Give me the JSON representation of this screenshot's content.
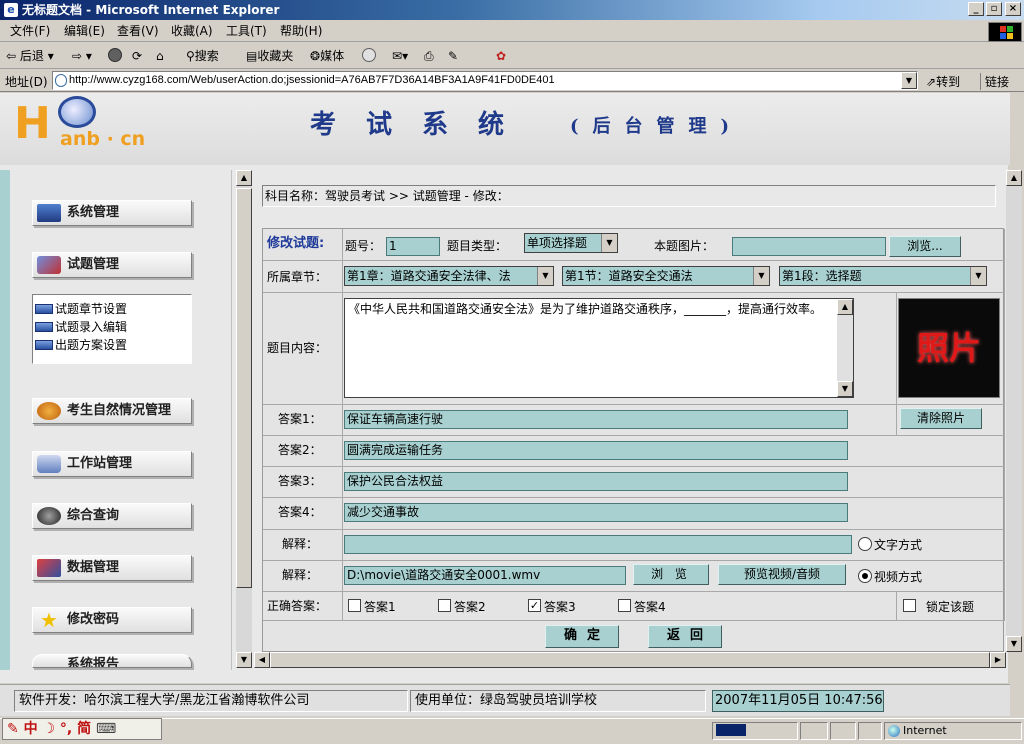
{
  "window": {
    "title": "无标题文档 - Microsoft Internet Explorer",
    "buttons": {
      "minimize": "_",
      "maximize": "▫",
      "close": "×"
    }
  },
  "menu": [
    "文件(F)",
    "编辑(E)",
    "查看(V)",
    "收藏(A)",
    "工具(T)",
    "帮助(H)"
  ],
  "toolbar": {
    "back": "后退",
    "search": "搜索",
    "favorites": "收藏夹",
    "media": "媒体"
  },
  "address": {
    "label": "地址(D)",
    "url": "http://www.cyzg168.com/Web/userAction.do;jsessionid=A76AB7F7D36A14BF3A1A9F41FD0DE401",
    "go": "转到",
    "links": "链接"
  },
  "header": {
    "logo_h": "H",
    "logo_text": "anb · cn",
    "title": "考试系统",
    "subtitle": "(后台管理)"
  },
  "sidebar": {
    "items": [
      {
        "label": "系统管理"
      },
      {
        "label": "试题管理"
      },
      {
        "label": "考生自然情况管理"
      },
      {
        "label": "工作站管理"
      },
      {
        "label": "综合查询"
      },
      {
        "label": "数据管理"
      },
      {
        "label": "修改密码"
      },
      {
        "label": "系统报告"
      }
    ],
    "subitems": [
      {
        "label": "试题章节设置"
      },
      {
        "label": "试题录入编辑"
      },
      {
        "label": "出题方案设置"
      }
    ]
  },
  "breadcrumb": "科目名称：驾驶员考试 >> 试题管理 - 修改：",
  "form": {
    "heading": "修改试题:",
    "num_label": "题号：",
    "num_value": "1",
    "type_label": "题目类型：",
    "type_value": "单项选择题",
    "image_label": "本题图片：",
    "image_value": "",
    "browse_label": "浏览...",
    "chapter_label": "所属章节：",
    "chapter_value": "第1章：道路交通安全法律、法",
    "section_value": "第1节：道路安全交通法",
    "segment_value": "第1段：选择题",
    "content_label": "题目内容：",
    "content_value": "《中华人民共和国道路交通安全法》是为了维护道路交通秩序，_______，提高通行效率。",
    "photo_text": "照片",
    "clear_photo": "清除照片",
    "answers": [
      {
        "label": "答案1：",
        "value": "保证车辆高速行驶"
      },
      {
        "label": "答案2：",
        "value": "圆满完成运输任务"
      },
      {
        "label": "答案3：",
        "value": "保护公民合法权益"
      },
      {
        "label": "答案4：",
        "value": "减少交通事故"
      }
    ],
    "explain_label": "解释：",
    "explain_text_value": "",
    "text_mode": "文字方式",
    "explain_video_label": "解释：",
    "video_path": "D:\\movie\\道路交通安全0001.wmv",
    "browse2": "浏 览",
    "preview": "预览视频/音频",
    "video_mode": "视频方式",
    "correct_label": "正确答案：",
    "choices": [
      {
        "label": "答案1",
        "checked": false
      },
      {
        "label": "答案2",
        "checked": false
      },
      {
        "label": "答案3",
        "checked": true
      },
      {
        "label": "答案4",
        "checked": false
      }
    ],
    "lock_label": "锁定该题",
    "confirm": "确定",
    "back": "返回"
  },
  "footer": {
    "developer": "软件开发：哈尔滨工程大学/黑龙江省瀚博软件公司",
    "user_unit": "使用单位：绿岛驾驶员培训学校",
    "datetime": "2007年11月05日  10:47:56"
  },
  "status": {
    "ime": "中 ☽ °, 简",
    "zone": "Internet"
  },
  "colors": {
    "field_bg": "#a8d0d0",
    "title_blue": "#1f3a8a",
    "logo_orange": "#f0a020"
  }
}
